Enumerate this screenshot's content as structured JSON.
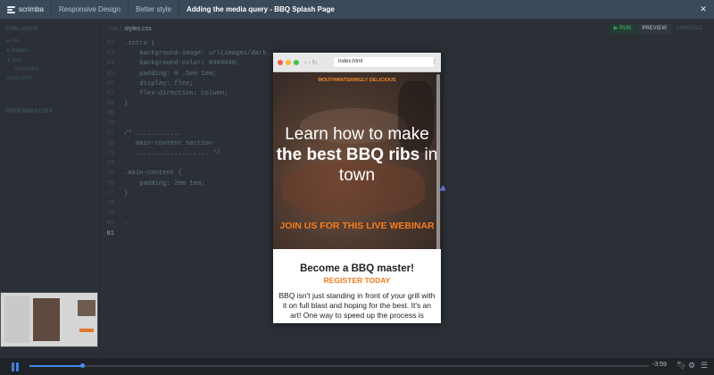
{
  "topbar": {
    "logo": "scrimba",
    "crumbs": [
      "Responsive Design",
      "Better style"
    ],
    "active_title": "Adding the media query - BBQ Splash Page",
    "close_label": "✕"
  },
  "sidebar": {
    "explorer_label": "EXPLORER",
    "items": [
      "css",
      "images",
      "html",
      "index.html",
      "index.html"
    ],
    "dependencies_label": "DEPENDENCIES"
  },
  "editor": {
    "path": "css /",
    "filename": "styles.css",
    "run_label": "▶ RUN",
    "preview_label": "PREVIEW",
    "console_label": "CONSOLE",
    "lines": [
      {
        "n": "62",
        "t": ".intro {"
      },
      {
        "n": "63",
        "t": "    background-image: url(images/dark..."
      },
      {
        "n": "64",
        "t": "    background-color: #404040;"
      },
      {
        "n": "65",
        "t": "    padding: 0 .5em 1em;"
      },
      {
        "n": "66",
        "t": "    display: flex;"
      },
      {
        "n": "67",
        "t": "    flex-direction: column;"
      },
      {
        "n": "68",
        "t": "}"
      },
      {
        "n": "69",
        "t": ""
      },
      {
        "n": "70",
        "t": ""
      },
      {
        "n": "71",
        "t": "/* ............"
      },
      {
        "n": "72",
        "t": "   main-content section"
      },
      {
        "n": "73",
        "t": "   ....................*/"
      },
      {
        "n": "74",
        "t": ""
      },
      {
        "n": "75",
        "t": ".main-content {"
      },
      {
        "n": "76",
        "t": "    padding: 2em 1em;"
      },
      {
        "n": "77",
        "t": "}"
      },
      {
        "n": "78",
        "t": ""
      },
      {
        "n": "79",
        "t": ""
      },
      {
        "n": "80",
        "t": "."
      },
      {
        "n": "81",
        "t": ""
      }
    ]
  },
  "browser": {
    "url": "index.html",
    "nav_icons": "‹ › ↻",
    "menu_icon": "⋮",
    "tagline": "MOUTHWATERINGLY DELICIOUS",
    "headline_1": "Learn how to make",
    "headline_bold": "the best BBQ ribs",
    "headline_2": "in",
    "headline_3": "town",
    "cta": "JOIN US FOR THIS LIVE WEBINAR",
    "section_title": "Become a BBQ master!",
    "section_sub": "REGISTER TODAY",
    "section_body": "BBQ isn't just standing in front of your grill with it on full blast and hoping for the best. It's an art! One way to speed up the process is"
  },
  "player": {
    "time": "-3:59",
    "progress": 0.085
  },
  "colors": {
    "accent": "#f57d1f",
    "play": "#3f88e8",
    "run": "#3a9b64"
  }
}
